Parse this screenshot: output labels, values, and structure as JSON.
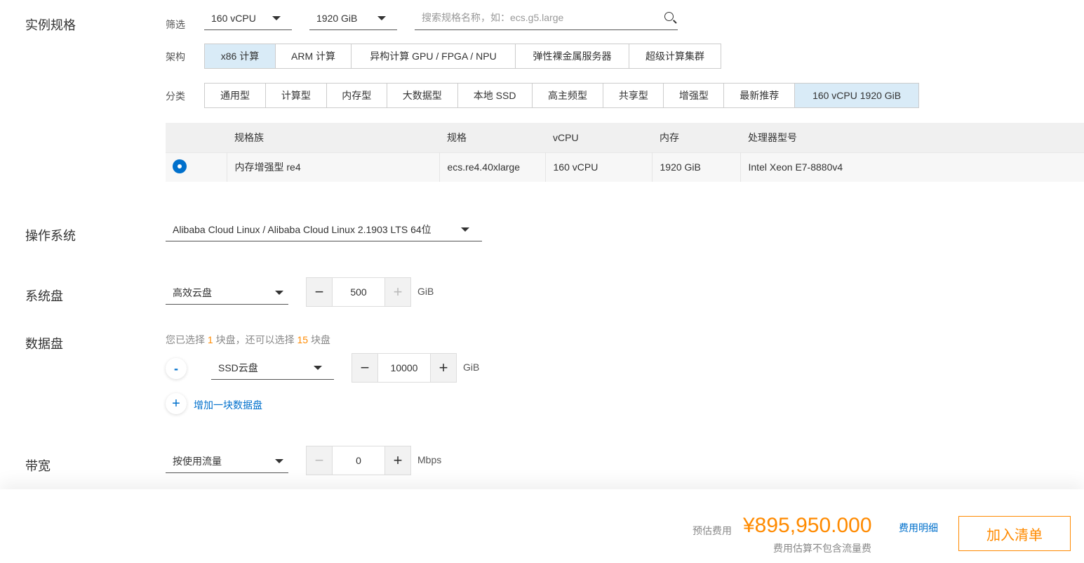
{
  "instance_spec": {
    "section_label": "实例规格",
    "filter_label": "筛选",
    "vcpu_filter": "160 vCPU",
    "mem_filter": "1920 GiB",
    "search_placeholder": "搜索规格名称，如：ecs.g5.large",
    "arch_label": "架构",
    "arch_options": [
      "x86 计算",
      "ARM 计算",
      "异构计算 GPU / FPGA / NPU",
      "弹性裸金属服务器",
      "超级计算集群"
    ],
    "arch_active": 0,
    "category_label": "分类",
    "category_options": [
      "通用型",
      "计算型",
      "内存型",
      "大数据型",
      "本地 SSD",
      "高主频型",
      "共享型",
      "增强型",
      "最新推荐",
      "160 vCPU 1920 GiB"
    ],
    "category_active": 9,
    "table_headers": [
      "规格族",
      "规格",
      "vCPU",
      "内存",
      "处理器型号"
    ],
    "table_rows": [
      {
        "family": "内存增强型 re4",
        "spec": "ecs.re4.40xlarge",
        "vcpu": "160 vCPU",
        "memory": "1920 GiB",
        "cpu": "Intel Xeon E7-8880v4"
      }
    ]
  },
  "os": {
    "section_label": "操作系统",
    "value": "Alibaba Cloud Linux / Alibaba Cloud Linux 2.1903 LTS 64位"
  },
  "system_disk": {
    "section_label": "系统盘",
    "type": "高效云盘",
    "size": "500",
    "unit": "GiB"
  },
  "data_disk": {
    "section_label": "数据盘",
    "hint_prefix": "您已选择",
    "hint_selected": "1",
    "hint_middle": "块盘，还可以选择",
    "hint_remaining": "15",
    "hint_suffix": "块盘",
    "remove_symbol": "-",
    "type": "SSD云盘",
    "size": "10000",
    "unit": "GiB",
    "add_symbol": "+",
    "add_label": "增加一块数据盘"
  },
  "bandwidth": {
    "section_label": "带宽",
    "type": "按使用流量",
    "value": "0",
    "unit": "Mbps"
  },
  "footer": {
    "cost_label": "预估费用",
    "cost_value": "¥895,950.000",
    "cost_note": "费用估算不包含流量费",
    "detail_link": "费用明细",
    "add_button": "加入清单"
  },
  "stepper_symbols": {
    "minus": "−",
    "plus": "+"
  },
  "colors": {
    "accent_blue": "#0070cc",
    "accent_orange": "#ff8a00",
    "active_bg": "#d9ebf7"
  }
}
